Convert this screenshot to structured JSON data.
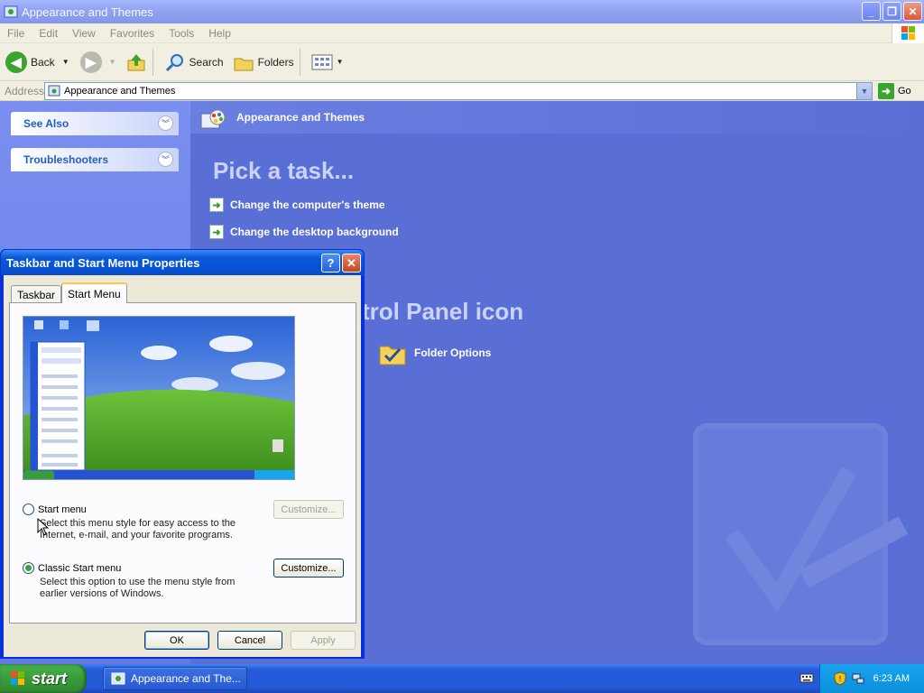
{
  "window": {
    "title": "Appearance and Themes"
  },
  "menu": {
    "items": [
      "File",
      "Edit",
      "View",
      "Favorites",
      "Tools",
      "Help"
    ]
  },
  "toolbar": {
    "back": "Back",
    "search": "Search",
    "folders": "Folders"
  },
  "address": {
    "label": "Address",
    "value": "Appearance and Themes",
    "go": "Go"
  },
  "sidebar": {
    "panels": [
      {
        "label": "See Also"
      },
      {
        "label": "Troubleshooters"
      }
    ]
  },
  "main": {
    "header": "Appearance and Themes",
    "pick_task": "Pick a task...",
    "tasks": [
      {
        "label": "Change the computer's theme"
      },
      {
        "label": "Change the desktop background"
      }
    ],
    "or_pick_partial": "trol Panel icon",
    "icons": [
      {
        "label": "Folder Options"
      }
    ]
  },
  "dialog": {
    "title": "Taskbar and Start Menu Properties",
    "tabs": [
      "Taskbar",
      "Start Menu"
    ],
    "active_tab": "Start Menu",
    "options": [
      {
        "label": "Start menu",
        "description": "Select this menu style for easy access to the Internet, e-mail, and your favorite programs.",
        "selected": false,
        "customize": "Customize...",
        "customize_enabled": false
      },
      {
        "label": "Classic Start menu",
        "description": "Select this option to use the menu style from earlier versions of Windows.",
        "selected": true,
        "customize": "Customize...",
        "customize_enabled": true
      }
    ],
    "buttons": {
      "ok": "OK",
      "cancel": "Cancel",
      "apply": "Apply"
    }
  },
  "taskbar": {
    "start": "start",
    "task_label": "Appearance and The...",
    "clock": "6:23 AM"
  },
  "colors": {
    "accent": "#0a5adb",
    "pane": "#5a6fd6",
    "start_green": "#3a9c3c"
  }
}
